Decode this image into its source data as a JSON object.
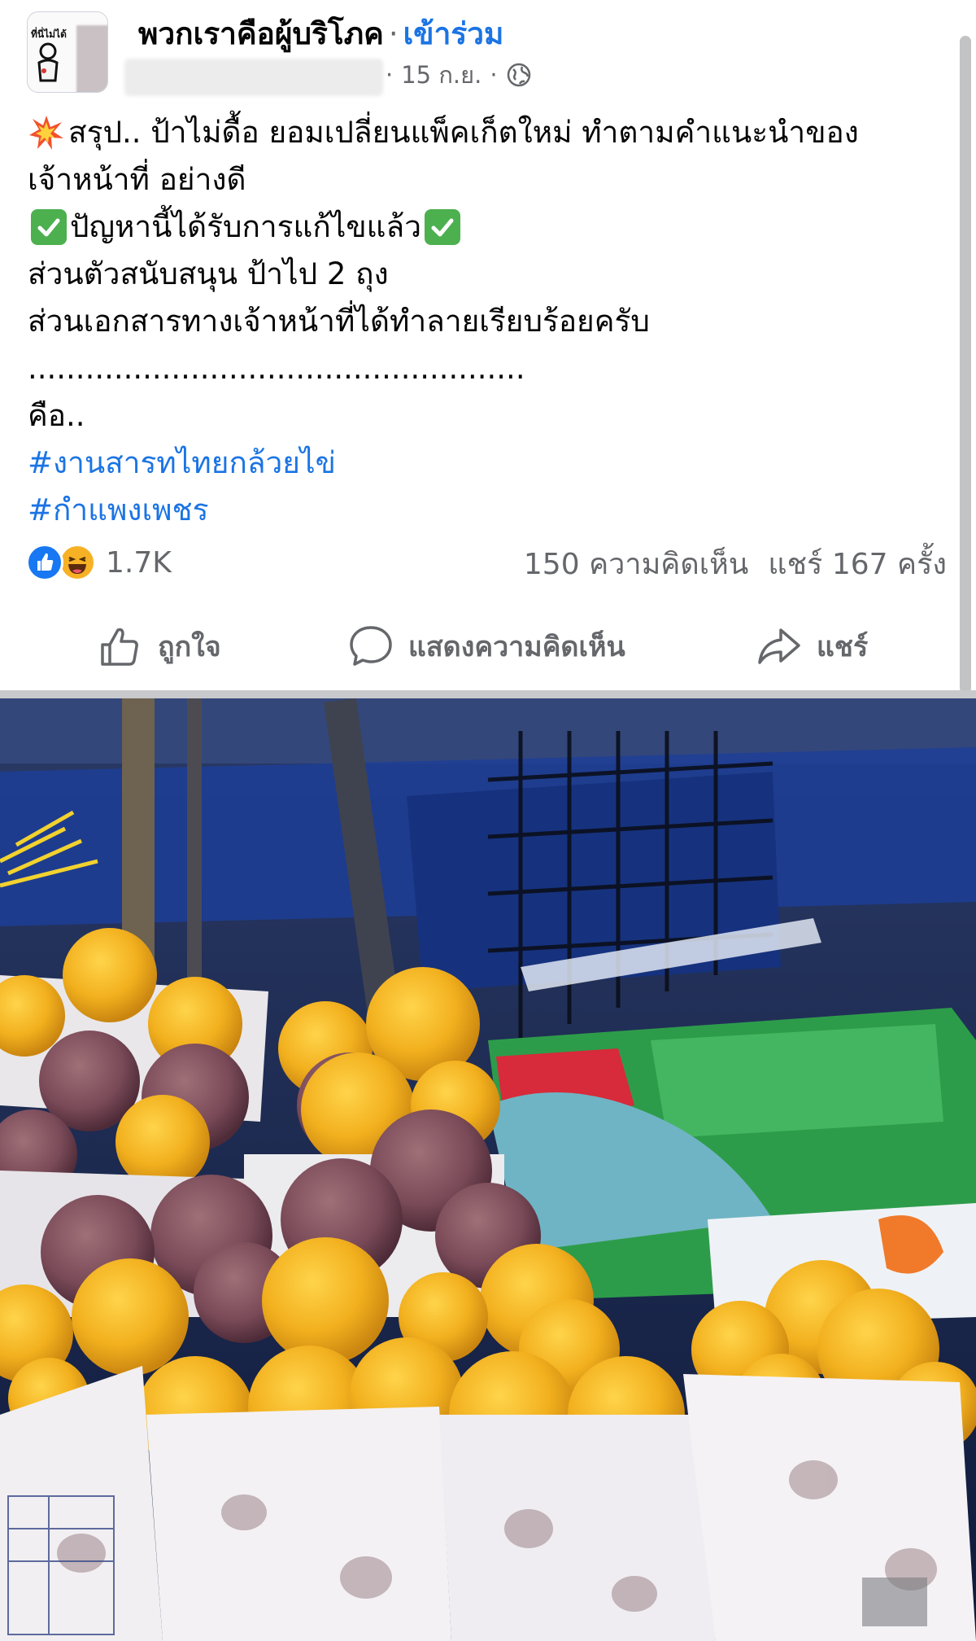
{
  "header": {
    "avatar_text": "ที่นี่ไม่ได้",
    "group_name": "พวกเราคือผู้บริโภค",
    "separator": "·",
    "join_label": "เข้าร่วม",
    "date": "15 ก.ย.",
    "audience_icon": "globe-icon"
  },
  "post": {
    "line1": "สรุป.. ป้าไม่ดื้อ ยอมเปลี่ยนแพ็คเก็ตใหม่  ทำตามคำแนะนำของ",
    "line2": "เจ้าหน้าที่ อย่างดี",
    "line3": "ปัญหานี้ได้รับการแก้ไขแล้ว",
    "line4": "ส่วนตัวสนับสนุน ป้าไป 2 ถุง",
    "line5": "ส่วนเอกสารทางเจ้าหน้าที่ได้ทำลายเรียบร้อยครับ",
    "line6": "....................................................",
    "line7": "คือ..",
    "hashtags": [
      "#งานสารทไทยกล้วยไข่",
      "#กำแพงเพชร"
    ]
  },
  "stats": {
    "reactions_count": "1.7K",
    "comments": "150 ความคิดเห็น",
    "shares": "แชร์ 167 ครั้ง"
  },
  "actions": {
    "like": "ถูกใจ",
    "comment": "แสดงความคิดเห็น",
    "share": "แชร์"
  },
  "colors": {
    "link": "#1b74e4",
    "secondary_text": "#65676b",
    "like_blue": "#1877f2",
    "haha_yellow": "#f7b125"
  }
}
